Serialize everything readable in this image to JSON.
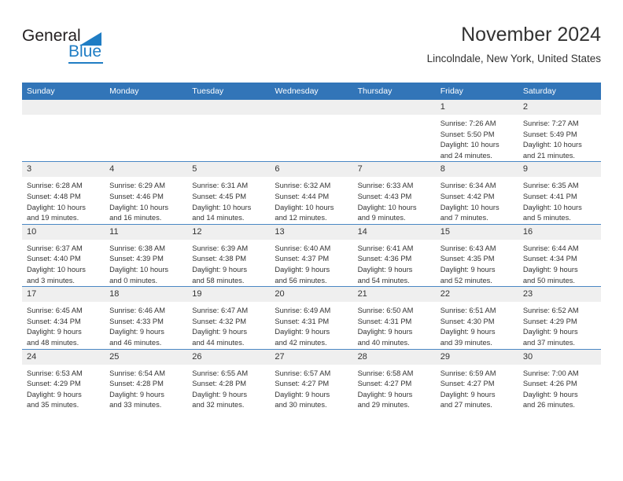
{
  "logo": {
    "text_top": "General",
    "text_bottom": "Blue",
    "accent_color": "#1f7dc4"
  },
  "header": {
    "title": "November 2024",
    "location": "Lincolndale, New York, United States"
  },
  "theme": {
    "header_bar_color": "#3275b8",
    "daynum_band_color": "#efefef",
    "row_border_color": "#4a87c4",
    "text_color": "#333333"
  },
  "calendar": {
    "weekday_headers": [
      "Sunday",
      "Monday",
      "Tuesday",
      "Wednesday",
      "Thursday",
      "Friday",
      "Saturday"
    ],
    "weeks": [
      [
        {
          "day": "",
          "lines": []
        },
        {
          "day": "",
          "lines": []
        },
        {
          "day": "",
          "lines": []
        },
        {
          "day": "",
          "lines": []
        },
        {
          "day": "",
          "lines": []
        },
        {
          "day": "1",
          "lines": [
            "Sunrise: 7:26 AM",
            "Sunset: 5:50 PM",
            "Daylight: 10 hours",
            "and 24 minutes."
          ]
        },
        {
          "day": "2",
          "lines": [
            "Sunrise: 7:27 AM",
            "Sunset: 5:49 PM",
            "Daylight: 10 hours",
            "and 21 minutes."
          ]
        }
      ],
      [
        {
          "day": "3",
          "lines": [
            "Sunrise: 6:28 AM",
            "Sunset: 4:48 PM",
            "Daylight: 10 hours",
            "and 19 minutes."
          ]
        },
        {
          "day": "4",
          "lines": [
            "Sunrise: 6:29 AM",
            "Sunset: 4:46 PM",
            "Daylight: 10 hours",
            "and 16 minutes."
          ]
        },
        {
          "day": "5",
          "lines": [
            "Sunrise: 6:31 AM",
            "Sunset: 4:45 PM",
            "Daylight: 10 hours",
            "and 14 minutes."
          ]
        },
        {
          "day": "6",
          "lines": [
            "Sunrise: 6:32 AM",
            "Sunset: 4:44 PM",
            "Daylight: 10 hours",
            "and 12 minutes."
          ]
        },
        {
          "day": "7",
          "lines": [
            "Sunrise: 6:33 AM",
            "Sunset: 4:43 PM",
            "Daylight: 10 hours",
            "and 9 minutes."
          ]
        },
        {
          "day": "8",
          "lines": [
            "Sunrise: 6:34 AM",
            "Sunset: 4:42 PM",
            "Daylight: 10 hours",
            "and 7 minutes."
          ]
        },
        {
          "day": "9",
          "lines": [
            "Sunrise: 6:35 AM",
            "Sunset: 4:41 PM",
            "Daylight: 10 hours",
            "and 5 minutes."
          ]
        }
      ],
      [
        {
          "day": "10",
          "lines": [
            "Sunrise: 6:37 AM",
            "Sunset: 4:40 PM",
            "Daylight: 10 hours",
            "and 3 minutes."
          ]
        },
        {
          "day": "11",
          "lines": [
            "Sunrise: 6:38 AM",
            "Sunset: 4:39 PM",
            "Daylight: 10 hours",
            "and 0 minutes."
          ]
        },
        {
          "day": "12",
          "lines": [
            "Sunrise: 6:39 AM",
            "Sunset: 4:38 PM",
            "Daylight: 9 hours",
            "and 58 minutes."
          ]
        },
        {
          "day": "13",
          "lines": [
            "Sunrise: 6:40 AM",
            "Sunset: 4:37 PM",
            "Daylight: 9 hours",
            "and 56 minutes."
          ]
        },
        {
          "day": "14",
          "lines": [
            "Sunrise: 6:41 AM",
            "Sunset: 4:36 PM",
            "Daylight: 9 hours",
            "and 54 minutes."
          ]
        },
        {
          "day": "15",
          "lines": [
            "Sunrise: 6:43 AM",
            "Sunset: 4:35 PM",
            "Daylight: 9 hours",
            "and 52 minutes."
          ]
        },
        {
          "day": "16",
          "lines": [
            "Sunrise: 6:44 AM",
            "Sunset: 4:34 PM",
            "Daylight: 9 hours",
            "and 50 minutes."
          ]
        }
      ],
      [
        {
          "day": "17",
          "lines": [
            "Sunrise: 6:45 AM",
            "Sunset: 4:34 PM",
            "Daylight: 9 hours",
            "and 48 minutes."
          ]
        },
        {
          "day": "18",
          "lines": [
            "Sunrise: 6:46 AM",
            "Sunset: 4:33 PM",
            "Daylight: 9 hours",
            "and 46 minutes."
          ]
        },
        {
          "day": "19",
          "lines": [
            "Sunrise: 6:47 AM",
            "Sunset: 4:32 PM",
            "Daylight: 9 hours",
            "and 44 minutes."
          ]
        },
        {
          "day": "20",
          "lines": [
            "Sunrise: 6:49 AM",
            "Sunset: 4:31 PM",
            "Daylight: 9 hours",
            "and 42 minutes."
          ]
        },
        {
          "day": "21",
          "lines": [
            "Sunrise: 6:50 AM",
            "Sunset: 4:31 PM",
            "Daylight: 9 hours",
            "and 40 minutes."
          ]
        },
        {
          "day": "22",
          "lines": [
            "Sunrise: 6:51 AM",
            "Sunset: 4:30 PM",
            "Daylight: 9 hours",
            "and 39 minutes."
          ]
        },
        {
          "day": "23",
          "lines": [
            "Sunrise: 6:52 AM",
            "Sunset: 4:29 PM",
            "Daylight: 9 hours",
            "and 37 minutes."
          ]
        }
      ],
      [
        {
          "day": "24",
          "lines": [
            "Sunrise: 6:53 AM",
            "Sunset: 4:29 PM",
            "Daylight: 9 hours",
            "and 35 minutes."
          ]
        },
        {
          "day": "25",
          "lines": [
            "Sunrise: 6:54 AM",
            "Sunset: 4:28 PM",
            "Daylight: 9 hours",
            "and 33 minutes."
          ]
        },
        {
          "day": "26",
          "lines": [
            "Sunrise: 6:55 AM",
            "Sunset: 4:28 PM",
            "Daylight: 9 hours",
            "and 32 minutes."
          ]
        },
        {
          "day": "27",
          "lines": [
            "Sunrise: 6:57 AM",
            "Sunset: 4:27 PM",
            "Daylight: 9 hours",
            "and 30 minutes."
          ]
        },
        {
          "day": "28",
          "lines": [
            "Sunrise: 6:58 AM",
            "Sunset: 4:27 PM",
            "Daylight: 9 hours",
            "and 29 minutes."
          ]
        },
        {
          "day": "29",
          "lines": [
            "Sunrise: 6:59 AM",
            "Sunset: 4:27 PM",
            "Daylight: 9 hours",
            "and 27 minutes."
          ]
        },
        {
          "day": "30",
          "lines": [
            "Sunrise: 7:00 AM",
            "Sunset: 4:26 PM",
            "Daylight: 9 hours",
            "and 26 minutes."
          ]
        }
      ]
    ]
  }
}
